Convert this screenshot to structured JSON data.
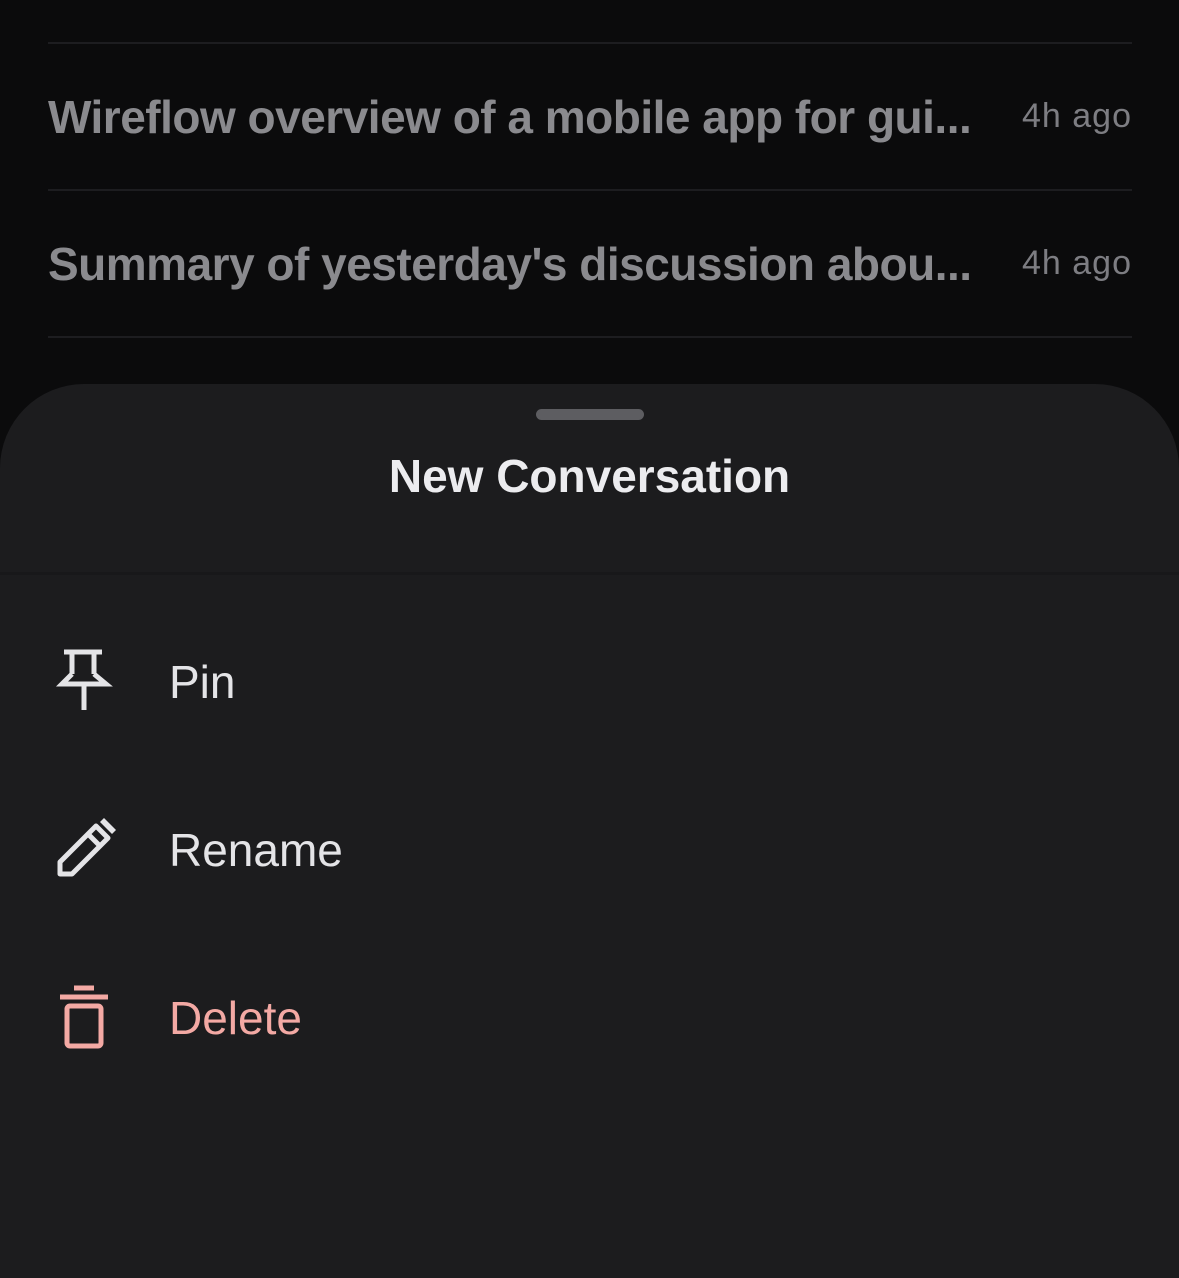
{
  "background_list": {
    "items": [
      {
        "title": "Wireflow overview of a mobile app for gui...",
        "time": "4h ago"
      },
      {
        "title": "Summary of yesterday's discussion abou...",
        "time": "4h ago"
      }
    ]
  },
  "sheet": {
    "title": "New Conversation",
    "actions": [
      {
        "label": "Pin",
        "icon": "pin-icon"
      },
      {
        "label": "Rename",
        "icon": "pencil-icon"
      },
      {
        "label": "Delete",
        "icon": "trash-icon"
      }
    ]
  },
  "colors": {
    "background": "#0b0b0c",
    "sheet": "#1c1c1e",
    "text": "#e4e4e7",
    "muted_text": "#8a8a8e",
    "danger": "#f3a9a4"
  }
}
